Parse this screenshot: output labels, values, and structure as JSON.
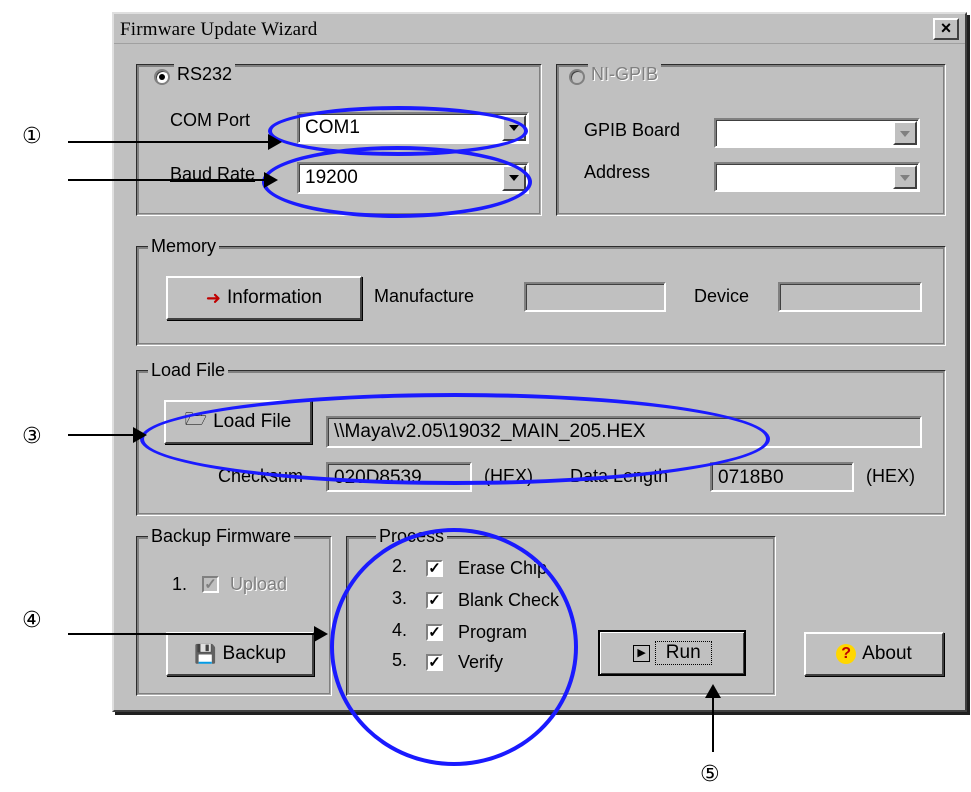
{
  "window": {
    "title": "Firmware Update Wizard",
    "close_glyph": "×"
  },
  "rs232": {
    "label": "RS232",
    "com_port_label": "COM Port",
    "com_port_value": "COM1",
    "baud_rate_label": "Baud Rate",
    "baud_rate_value": "19200"
  },
  "gpib": {
    "label": "NI-GPIB",
    "board_label": "GPIB Board",
    "board_value": "",
    "address_label": "Address",
    "address_value": ""
  },
  "memory": {
    "title": "Memory",
    "info_button": "Information",
    "manufacture_label": "Manufacture",
    "manufacture_value": "",
    "device_label": "Device",
    "device_value": ""
  },
  "load_file": {
    "title": "Load File",
    "button": "Load File",
    "path": "\\\\Maya\\v2.05\\19032_MAIN_205.HEX",
    "checksum_label": "Checksum",
    "checksum_value": "020D8539",
    "checksum_unit": "(HEX)",
    "data_length_label": "Data Length",
    "data_length_value": "0718B0",
    "data_length_unit": "(HEX)"
  },
  "backup": {
    "title": "Backup Firmware",
    "upload_num": "1.",
    "upload_label": "Upload",
    "upload_checked": true,
    "button": "Backup"
  },
  "process": {
    "title": "Process",
    "items": [
      {
        "num": "2.",
        "label": "Erase Chip",
        "checked": true
      },
      {
        "num": "3.",
        "label": "Blank Check",
        "checked": true
      },
      {
        "num": "4.",
        "label": "Program",
        "checked": true
      },
      {
        "num": "5.",
        "label": "Verify",
        "checked": true
      }
    ]
  },
  "buttons": {
    "run": "Run",
    "about": "About"
  },
  "annotations": {
    "a1": "①",
    "a3": "③",
    "a4": "④",
    "a5": "⑤"
  },
  "colors": {
    "highlight_ellipse": "#1a1aff",
    "window_bg": "#c0c0c0"
  }
}
